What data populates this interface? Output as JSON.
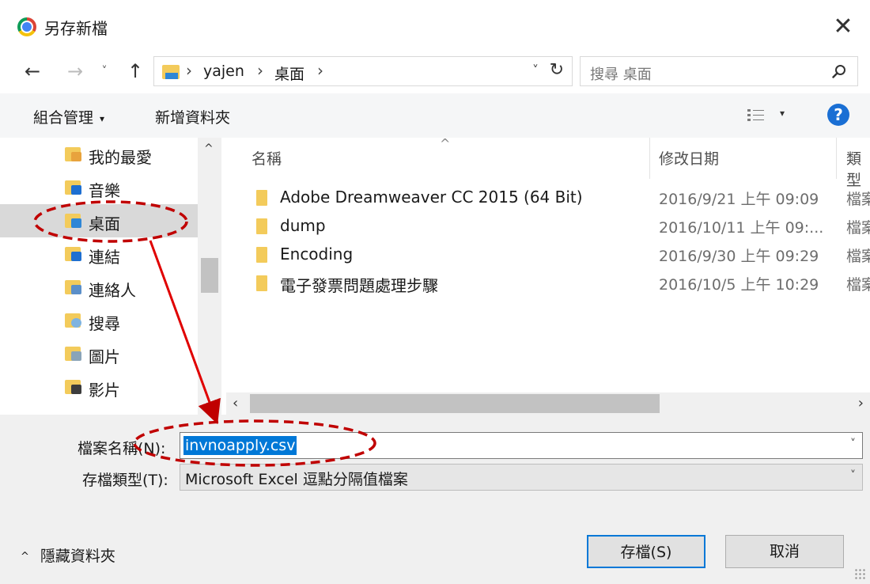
{
  "window": {
    "title": "另存新檔",
    "close_glyph": "✕"
  },
  "nav": {
    "back_glyph": "←",
    "forward_glyph": "→",
    "recent_glyph": "˅",
    "up_glyph": "↑",
    "breadcrumb": [
      "yajen",
      "桌面"
    ],
    "breadcrumb_sep": "›",
    "dropdown_glyph": "˅",
    "refresh_glyph": "↻",
    "search_placeholder": "搜尋 桌面"
  },
  "toolbar": {
    "organize_label": "組合管理",
    "caret": "▾",
    "new_folder_label": "新增資料夾",
    "view_caret": "▾",
    "help_glyph": "?"
  },
  "sidebar": {
    "items": [
      {
        "label": "我的最愛",
        "badge": "#e8a33d"
      },
      {
        "label": "音樂",
        "badge": "#1e6fd1"
      },
      {
        "label": "桌面",
        "badge": "#2e86d6",
        "selected": true
      },
      {
        "label": "連結",
        "badge": "#1e6fd1"
      },
      {
        "label": "連絡人",
        "badge": "#5b8fc9"
      },
      {
        "label": "搜尋",
        "badge": "#7fb3e0"
      },
      {
        "label": "圖片",
        "badge": "#8aa4b8"
      },
      {
        "label": "影片",
        "badge": "#3d3d3d"
      }
    ],
    "scroll_up_glyph": "^"
  },
  "filelist": {
    "columns": [
      "名稱",
      "修改日期",
      "類型"
    ],
    "sort_glyph": "^",
    "rows": [
      {
        "name": "Adobe Dreamweaver CC 2015 (64 Bit)",
        "date": "2016/9/21 上午 09:09",
        "type": "檔案"
      },
      {
        "name": "dump",
        "date": "2016/10/11 上午 09:...",
        "type": "檔案"
      },
      {
        "name": "Encoding",
        "date": "2016/9/30 上午 09:29",
        "type": "檔案"
      },
      {
        "name": "電子發票問題處理步驟",
        "date": "2016/10/5 上午 10:29",
        "type": "檔案"
      }
    ],
    "scroll_left_glyph": "‹",
    "scroll_right_glyph": "›"
  },
  "form": {
    "filename_label": "檔案名稱(N):",
    "filename_value": "invnoapply.csv",
    "type_label": "存檔類型(T):",
    "type_value": "Microsoft Excel 逗點分隔值檔案",
    "dropdown_glyph": "˅"
  },
  "footer": {
    "hide_folders_caret": "^",
    "hide_folders_label": "隱藏資料夾",
    "save_label": "存檔(S)",
    "cancel_label": "取消"
  },
  "colors": {
    "accent": "#0078d7",
    "annotation": "#c00000",
    "selection": "#d9d9d9"
  }
}
